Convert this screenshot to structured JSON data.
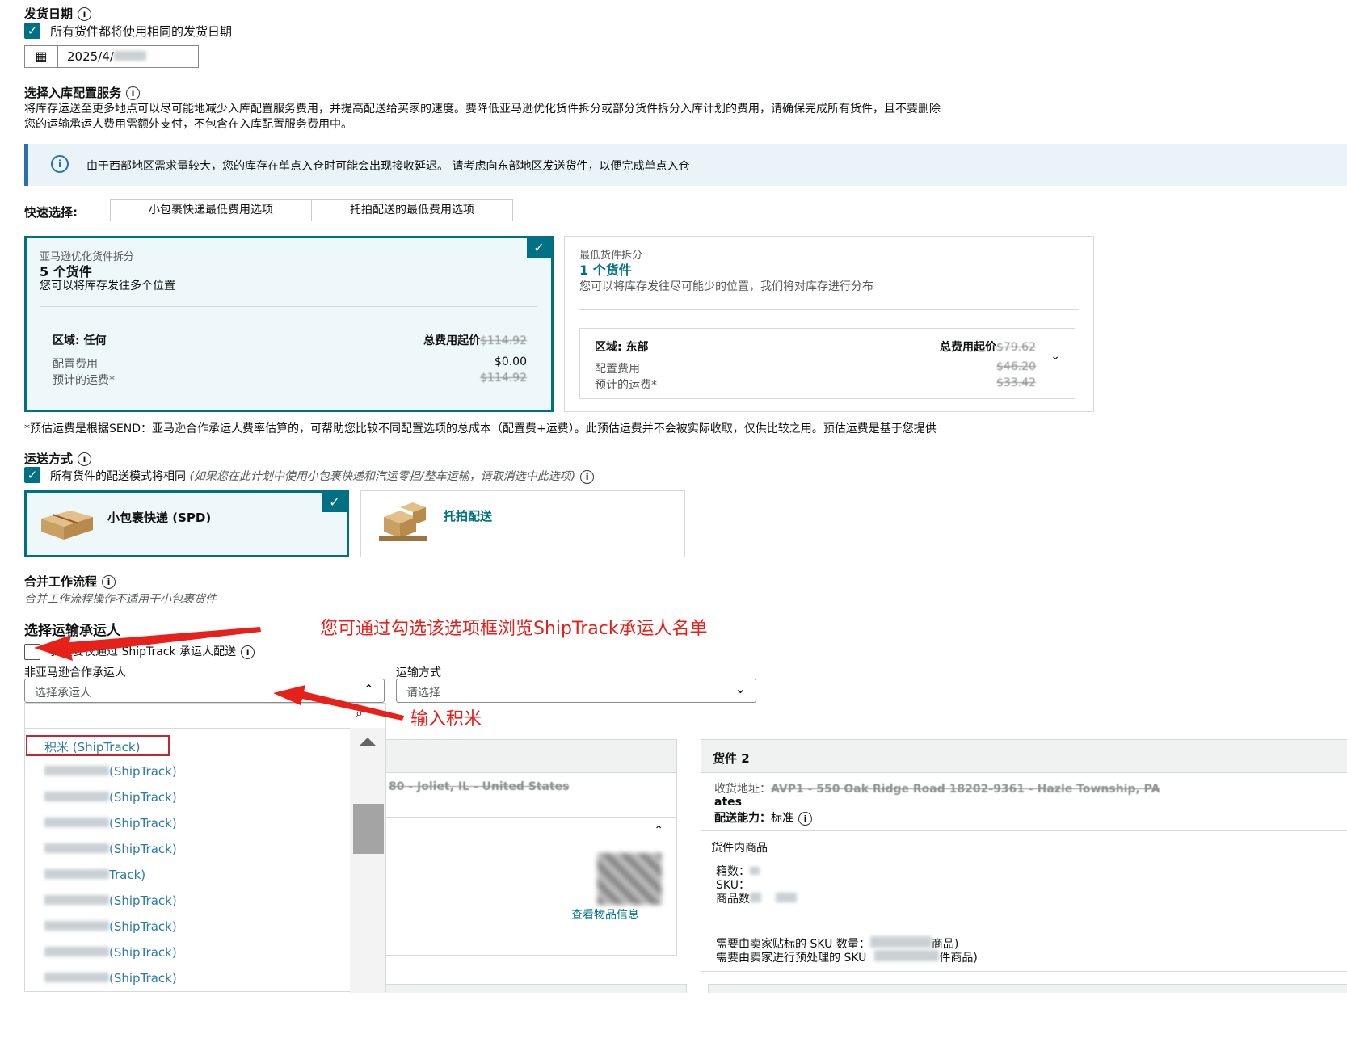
{
  "ship_date": {
    "title": "发货日期",
    "same_date_label": "所有货件都将使用相同的发货日期",
    "date_value": "2025/4/"
  },
  "inbound_service": {
    "title": "选择入库配置服务",
    "desc_line1": "将库存运送至更多地点可以尽可能地减少入库配置服务费用，并提高配送给买家的速度。要降低亚马逊优化货件拆分或部分货件拆分入库计划的费用，请确保完成所有货件，且不要删除",
    "desc_line2": "您的运输承运人费用需额外支付，不包含在入库配置服务费用中。",
    "notice": "由于西部地区需求量较大，您的库存在单点入仓时可能会出现接收延迟。 请考虑向东部地区发送货件，以便完成单点入仓"
  },
  "quick_select": {
    "label": "快速选择:",
    "options": [
      "小包裹快递最低费用选项",
      "托拍配送的最低费用选项"
    ]
  },
  "options": [
    {
      "subtitle": "亚马逊优化货件拆分",
      "title": "5 个货件",
      "desc": "您可以将库存发往多个位置",
      "region": "区域: 任何",
      "total_label": "总费用起价",
      "total_value": "$114.92",
      "fee_label": "配置费用",
      "fee_value": "$0.00",
      "shipping_label": "预计的运费*",
      "shipping_value": "$114.92"
    },
    {
      "subtitle": "最低货件拆分",
      "title": "1 个货件",
      "desc": "您可以将库存发往尽可能少的位置，我们将对库存进行分布",
      "region": "区域: 东部",
      "total_label": "总费用起价",
      "total_value": "$79.62",
      "fee_label": "配置费用",
      "fee_value": "$46.20",
      "shipping_label": "预计的运费*",
      "shipping_value": "$33.42"
    }
  ],
  "footnote": "*预估运费是根据SEND：亚马逊合作承运人费率估算的，可帮助您比较不同配置选项的总成本（配置费+运费）。此预估运费并不会被实际收取，仅供比较之用。预估运费是基于您提供",
  "shipping_mode": {
    "title": "运送方式",
    "same_mode_label": "所有货件的配送模式将相同",
    "same_mode_hint": "(如果您在此计划中使用小包裹快递和汽运零担/整车运输，请取消选中此选项)",
    "spd": "小包裹快递 (SPD)",
    "ltl": "托拍配送"
  },
  "merge": {
    "title": "合并工作流程",
    "desc": "合并工作流程操作不适用于小包裹货件"
  },
  "carrier": {
    "title": "选择运输承运人",
    "shiptrack_only": "我只要仅通过 ShipTrack 承运人配送",
    "non_partner_label": "非亚马逊合作承运人",
    "select_placeholder": "选择承运人",
    "mode_label": "运输方式",
    "mode_placeholder": "请选择",
    "list": [
      "积米 (ShipTrack)",
      "(ShipTrack)",
      "(ShipTrack)",
      "(ShipTrack)",
      "(ShipTrack)",
      "Track)",
      "(ShipTrack)",
      "(ShipTrack)",
      "(ShipTrack)",
      "(ShipTrack)"
    ]
  },
  "annotations": {
    "note1": "您可通过勾选该选项框浏览ShipTrack承运人名单",
    "note2": "输入积米"
  },
  "shipment2": {
    "title": "货件 2",
    "address_label": "收货地址：",
    "address_value": "AVP1 - 550 Oak Ridge Road 18202-9361 - Hazle Township, PA",
    "address_tail": "ates",
    "capability_label": "配送能力：",
    "capability_value": "标准",
    "items_title": "货件内商品",
    "boxes_label": "箱数：",
    "sku_label": "SKU：",
    "units_label": "商品数",
    "seller_label_text": "需要由卖家贴标的 SKU 数量：",
    "seller_label_tail": "商品)",
    "seller_prep_text": "需要由卖家进行预处理的 SKU",
    "seller_prep_tail": "件商品)"
  },
  "shipment1": {
    "address_partial": "80 - Joliet, IL - United States",
    "view_items": "查看物品信息"
  },
  "colors": {
    "accent": "#007185",
    "annotation": "#e8201a"
  }
}
